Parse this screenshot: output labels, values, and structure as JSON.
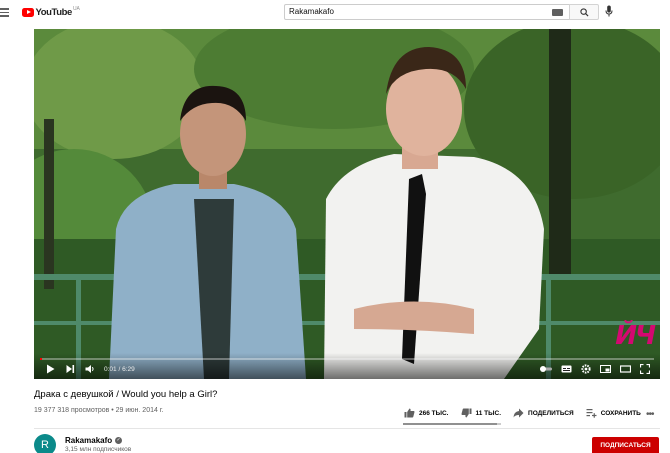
{
  "header": {
    "logo_text": "YouTube",
    "logo_country": "UA",
    "search_value": "Rakamakafo"
  },
  "player": {
    "current_time": "0:01",
    "duration": "6:29",
    "separator": "/",
    "watermark": "ЙЧ",
    "progress": 0.003
  },
  "video": {
    "title": "Драка с девушкой / Would you help a Girl?",
    "meta": "19 377 318 просмотров • 29 июн. 2014 г.",
    "likes": "266 ТЫС.",
    "dislikes": "11 ТЫС.",
    "share_label": "ПОДЕЛИТЬСЯ",
    "save_label": "СОХРАНИТЬ",
    "like_ratio": 0.96
  },
  "channel": {
    "avatar_letter": "R",
    "name": "Rakamakafo",
    "subscribers": "3,15 млн подписчиков",
    "subscribe_label": "ПОДПИСАТЬСЯ",
    "avatar_color": "#0b8a8a"
  },
  "colors": {
    "brand": "#ff0000",
    "subscribe": "#cc0000"
  }
}
